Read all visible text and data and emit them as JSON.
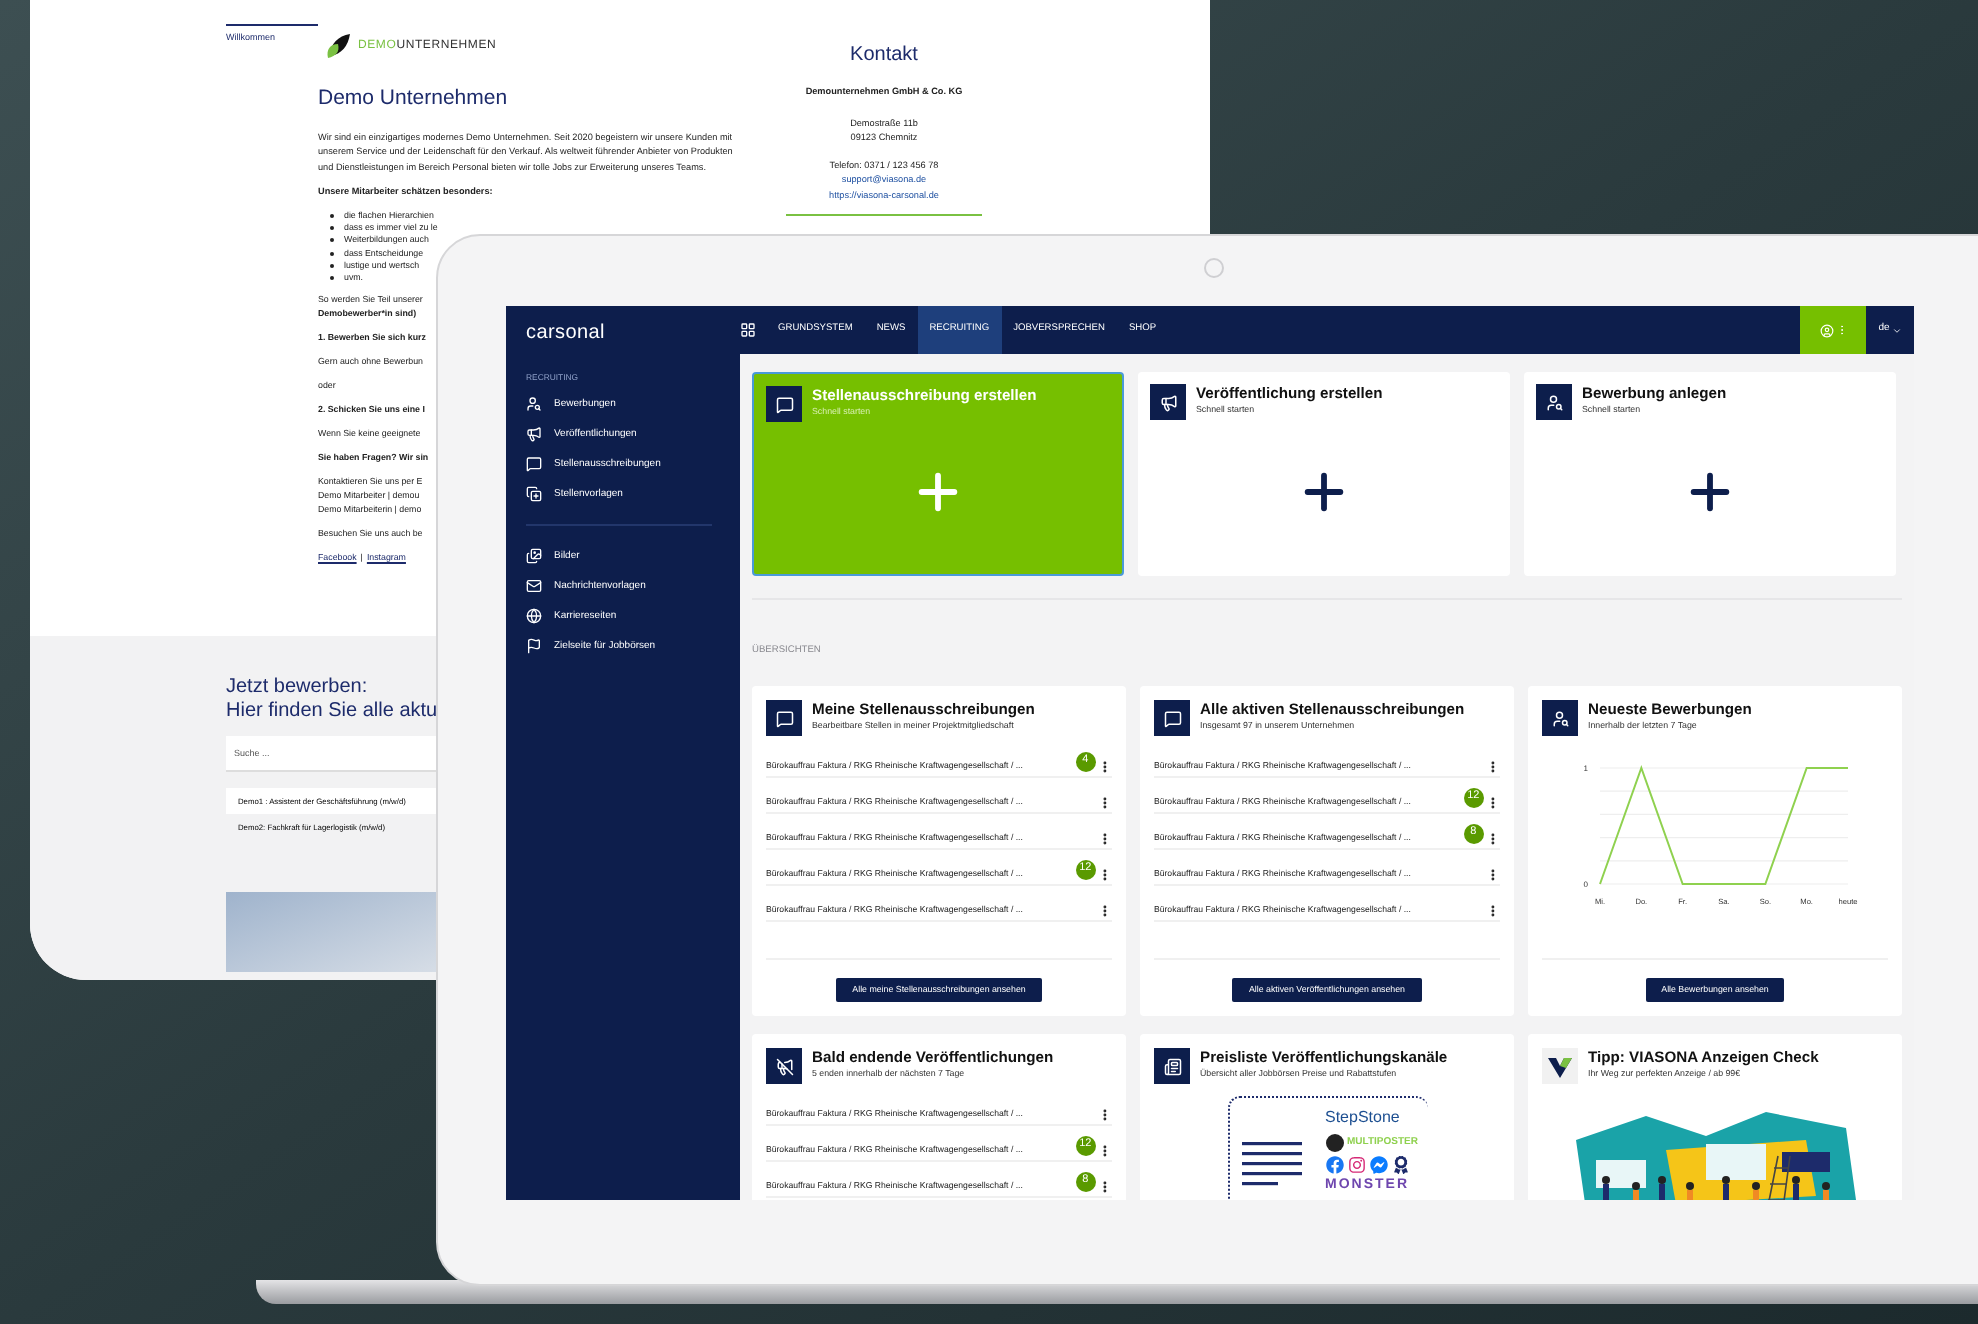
{
  "website": {
    "tab": {
      "label": "Willkommen",
      "selected": true
    },
    "logo": {
      "accent": "DEMO",
      "rest": "UNTERNEHMEN"
    },
    "heading": "Demo Unternehmen",
    "intro": "Wir sind ein einzigartiges modernes Demo Unternehmen. Seit 2020 begeistern wir unsere Kunden mit unserem Service und der Leidenschaft für den Verkauf. Als weltweit führender Anbieter von Produkten und Dienstleistungen im Bereich Personal bieten wir tolle Jobs zur Erweiterung unseres Teams.",
    "list_heading": "Unsere Mitarbeiter schätzen besonders:",
    "bullets": [
      "die flachen Hierarchien",
      "dass es immer viel zu le",
      "Weiterbildungen auch",
      "dass Entscheidunge",
      "lustige und wertsch",
      "uvm."
    ],
    "blocks": [
      {
        "lines": [
          {
            "text": "So werden Sie Teil unserer",
            "bold": false
          },
          {
            "text": "Demobewerber*in sind)",
            "bold": true
          }
        ]
      },
      {
        "lines": [
          {
            "text": "1. Bewerben Sie sich kurz",
            "bold": true
          }
        ]
      },
      {
        "lines": [
          {
            "text": "Gern auch ohne Bewerbun",
            "bold": false
          }
        ]
      },
      {
        "lines": [
          {
            "text": "oder",
            "bold": false
          }
        ]
      },
      {
        "lines": [
          {
            "text": "2. Schicken Sie uns eine I",
            "bold": true
          }
        ]
      },
      {
        "lines": [
          {
            "text": "Wenn Sie keine geeignete",
            "bold": false
          }
        ]
      },
      {
        "lines": [
          {
            "text": "Sie haben Fragen? Wir sin",
            "bold": true
          }
        ]
      },
      {
        "lines": [
          {
            "text": "Kontaktieren Sie uns per E",
            "bold": false
          },
          {
            "text": "Demo Mitarbeiter | demou",
            "bold": false
          },
          {
            "text": "Demo Mitarbeiterin | demo",
            "bold": false
          }
        ]
      },
      {
        "lines": [
          {
            "text": "Besuchen Sie uns auch be",
            "bold": false
          }
        ]
      }
    ],
    "links": [
      "Facebook",
      "Instagram"
    ],
    "link_separator": "|",
    "contact": {
      "title": "Kontakt",
      "company": "Demounternehmen GmbH & Co. KG",
      "address": [
        "Demostraße 11b",
        "09123 Chemnitz"
      ],
      "phone": "Telefon: 0371 / 123 456 78",
      "links": [
        "support@viasona.de",
        "https://viasona-carsonal.de"
      ]
    },
    "apply": {
      "heading": [
        "Jetzt bewerben:",
        "Hier finden Sie alle aktu"
      ],
      "search_placeholder": "Suche ...",
      "jobs": [
        "Demo1 : Assistent der Geschäftsführung (m/w/d)",
        "Demo2: Fachkraft für Lagerlogistik (m/w/d)"
      ]
    }
  },
  "app": {
    "logo": "carsonal",
    "nav": [
      {
        "label": "GRUNDSYSTEM",
        "selected": false
      },
      {
        "label": "NEWS",
        "selected": false
      },
      {
        "label": "RECRUITING",
        "selected": true
      },
      {
        "label": "JOBVERSPRECHEN",
        "selected": false
      },
      {
        "label": "SHOP",
        "selected": false
      }
    ],
    "language": "de",
    "sidebar": {
      "heading": "RECRUITING",
      "groups": [
        [
          "Bewerbungen",
          "Veröffentlichungen",
          "Stellenausschreibungen",
          "Stellenvorlagen"
        ],
        [
          "Bilder",
          "Nachrichtenvorlagen",
          "Karriereseiten",
          "Zielseite für Jobbörsen"
        ]
      ]
    },
    "quick_cards": [
      {
        "title": "Stellenausschreibung erstellen",
        "subtitle": "Schnell starten",
        "highlighted": true
      },
      {
        "title": "Veröffentlichung erstellen",
        "subtitle": "Schnell starten",
        "highlighted": false
      },
      {
        "title": "Bewerbung anlegen",
        "subtitle": "Schnell starten",
        "highlighted": false
      }
    ],
    "section_label": "ÜBERSICHTEN",
    "overview_cards": [
      {
        "kind": "list",
        "title": "Meine Stellenausschreibungen",
        "subtitle": "Bearbeitbare Stellen in meiner Projektmitgliedschaft",
        "rows": [
          {
            "text": "Bürokauffrau Faktura / RKG Rheinische Kraftwagengesellschaft / ...",
            "badge": "4"
          },
          {
            "text": "Bürokauffrau Faktura / RKG Rheinische Kraftwagengesellschaft / ..."
          },
          {
            "text": "Bürokauffrau Faktura / RKG Rheinische Kraftwagengesellschaft / ..."
          },
          {
            "text": "Bürokauffrau Faktura / RKG Rheinische Kraftwagengesellschaft / ...",
            "badge": "12"
          },
          {
            "text": "Bürokauffrau Faktura / RKG Rheinische Kraftwagengesellschaft / ..."
          }
        ],
        "button": "Alle meine Stellenausschreibungen ansehen"
      },
      {
        "kind": "list",
        "title": "Alle aktiven Stellenausschreibungen",
        "subtitle": "Insgesamt 97 in unserem Unternehmen",
        "rows": [
          {
            "text": "Bürokauffrau Faktura / RKG Rheinische Kraftwagengesellschaft / ..."
          },
          {
            "text": "Bürokauffrau Faktura / RKG Rheinische Kraftwagengesellschaft / ...",
            "badge": "12"
          },
          {
            "text": "Bürokauffrau Faktura / RKG Rheinische Kraftwagengesellschaft / ...",
            "badge": "8"
          },
          {
            "text": "Bürokauffrau Faktura / RKG Rheinische Kraftwagengesellschaft / ..."
          },
          {
            "text": "Bürokauffrau Faktura / RKG Rheinische Kraftwagengesellschaft / ..."
          }
        ],
        "button": "Alle aktiven Veröffentlichungen ansehen"
      },
      {
        "kind": "chart",
        "title": "Neueste Bewerbungen",
        "subtitle": "Innerhalb der letzten 7 Tage",
        "chart_data": {
          "type": "line",
          "categories": [
            "Mi.",
            "Do.",
            "Fr.",
            "Sa.",
            "So.",
            "Mo.",
            "heute"
          ],
          "series": [
            {
              "color": "#8fd14f",
              "values": [
                0,
                1,
                0,
                0,
                0,
                1,
                1
              ]
            }
          ],
          "yticks": [
            0,
            1
          ],
          "ylim": [
            0,
            1
          ]
        },
        "button": "Alle Bewerbungen ansehen"
      },
      {
        "kind": "list",
        "title": "Bald endende Veröffentlichungen",
        "subtitle": "5 enden innerhalb der nächsten 7 Tage",
        "rows": [
          {
            "text": "Bürokauffrau Faktura / RKG Rheinische Kraftwagengesellschaft / ..."
          },
          {
            "text": "Bürokauffrau Faktura / RKG Rheinische Kraftwagengesellschaft / ...",
            "badge": "12"
          },
          {
            "text": "Bürokauffrau Faktura / RKG Rheinische Kraftwagengesellschaft / ...",
            "badge": "8"
          }
        ]
      },
      {
        "kind": "pricelist",
        "title": "Preisliste Veröffentlichungskanäle",
        "subtitle": "Übersicht aller Jobbörsen Preise und Rabattstufen",
        "logos": [
          "StepStone",
          "MULTIPOSTER",
          "MONSTER"
        ]
      },
      {
        "kind": "promo",
        "title": "Tipp: VIASONA Anzeigen Check",
        "subtitle": "Ihr Weg zur perfekten Anzeige / ab 99€"
      }
    ]
  }
}
